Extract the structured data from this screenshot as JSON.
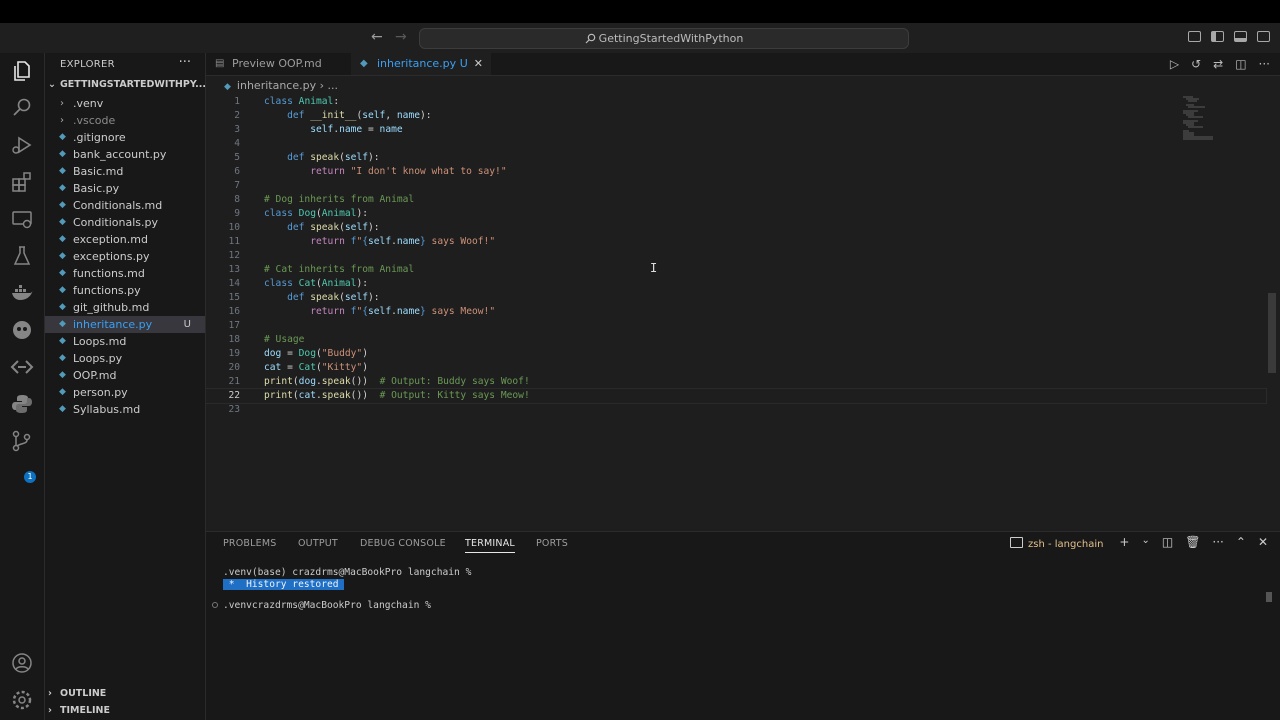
{
  "titlebar": {
    "command_center": "GettingStartedWithPython"
  },
  "activity_bar": {
    "icons": [
      "files-icon",
      "search-icon",
      "run-debug-icon",
      "extensions-icon",
      "remote-explorer-icon",
      "testing-icon",
      "docker-icon",
      "copilot-icon",
      "live-share-icon",
      "python-icon",
      "source-control-icon"
    ],
    "source_control_badge": "1"
  },
  "sidebar": {
    "title": "EXPLORER",
    "more": "···",
    "folder": "GETTINGSTARTEDWITHPY...",
    "items": [
      {
        "label": ".venv",
        "kind": "folder"
      },
      {
        "label": ".vscode",
        "kind": "folder"
      },
      {
        "label": ".gitignore",
        "kind": "file"
      },
      {
        "label": "bank_account.py",
        "kind": "file"
      },
      {
        "label": "Basic.md",
        "kind": "file"
      },
      {
        "label": "Basic.py",
        "kind": "file"
      },
      {
        "label": "Conditionals.md",
        "kind": "file"
      },
      {
        "label": "Conditionals.py",
        "kind": "file"
      },
      {
        "label": "exception.md",
        "kind": "file"
      },
      {
        "label": "exceptions.py",
        "kind": "file"
      },
      {
        "label": "functions.md",
        "kind": "file"
      },
      {
        "label": "functions.py",
        "kind": "file"
      },
      {
        "label": "git_github.md",
        "kind": "file"
      },
      {
        "label": "inheritance.py",
        "kind": "file",
        "status": "U",
        "selected": true
      },
      {
        "label": "Loops.md",
        "kind": "file"
      },
      {
        "label": "Loops.py",
        "kind": "file"
      },
      {
        "label": "OOP.md",
        "kind": "file"
      },
      {
        "label": "person.py",
        "kind": "file"
      },
      {
        "label": "Syllabus.md",
        "kind": "file"
      }
    ],
    "outline": "OUTLINE",
    "timeline": "TIMELINE"
  },
  "tabs": [
    {
      "label": "Preview OOP.md",
      "active": false
    },
    {
      "label": "inheritance.py",
      "status": "U",
      "active": true
    }
  ],
  "breadcrumb": {
    "file": "inheritance.py",
    "sep": "›",
    "rest": "..."
  },
  "code": {
    "current_line": 22,
    "line_numbers": [
      "1",
      "2",
      "3",
      "4",
      "5",
      "6",
      "7",
      "8",
      "9",
      "10",
      "11",
      "12",
      "13",
      "14",
      "15",
      "16",
      "17",
      "18",
      "19",
      "20",
      "21",
      "22",
      "23"
    ]
  },
  "panel": {
    "tabs": [
      "PROBLEMS",
      "OUTPUT",
      "DEBUG CONSOLE",
      "TERMINAL",
      "PORTS"
    ],
    "active_tab": "TERMINAL",
    "terminal_name": "zsh - langchain",
    "terminal_lines": [
      ".venv(base) crazdrms@MacBookPro langchain %",
      " *  History restored ",
      ".venvcrazdrms@MacBookPro langchain %"
    ]
  },
  "colors": {
    "accent": "#3aa0f3",
    "terminal_title": "#e2c08d",
    "selection": "#1f6fc5"
  }
}
